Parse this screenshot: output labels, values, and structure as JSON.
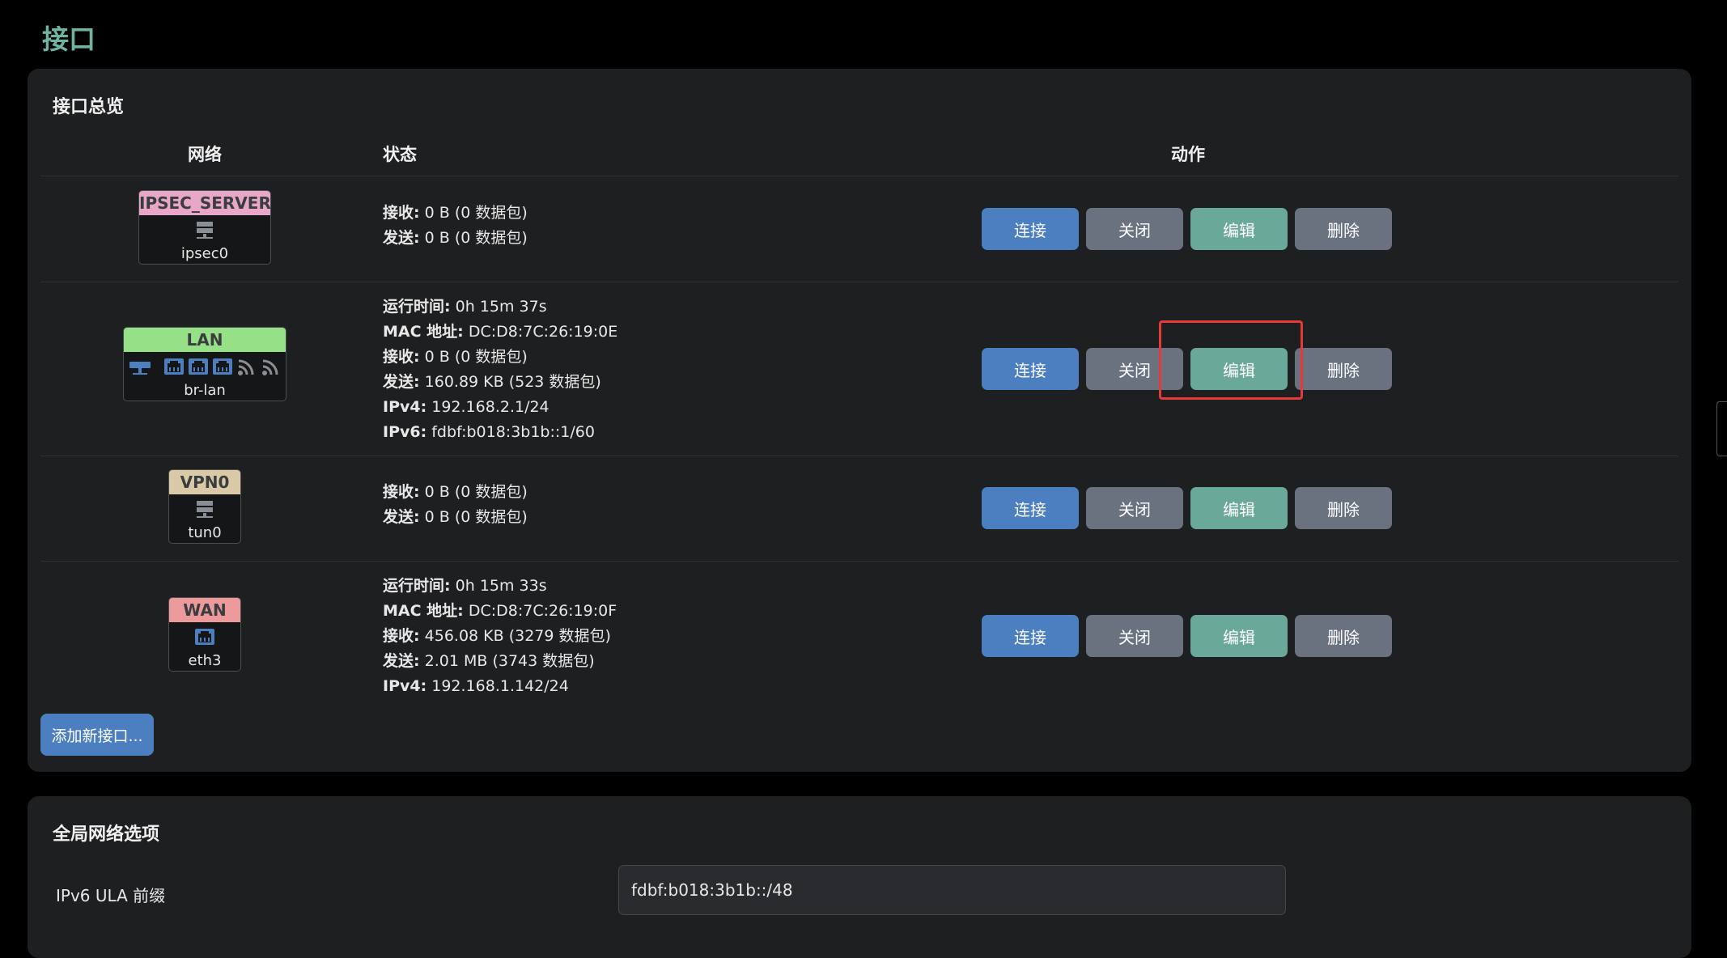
{
  "page": {
    "title": "接口"
  },
  "overview": {
    "title": "接口总览",
    "headers": {
      "network": "网络",
      "status": "状态",
      "actions": "动作"
    },
    "buttons": {
      "connect": "连接",
      "stop": "关闭",
      "edit": "编辑",
      "delete": "删除"
    },
    "add_button": "添加新接口...",
    "rows": [
      {
        "name": "IPSEC_SERVER",
        "device": "ipsec0",
        "color": "#e9a7c8",
        "icons": [
          "server-icon"
        ],
        "status": [
          {
            "k": "接收:",
            "v": " 0 B (0 数据包)"
          },
          {
            "k": "发送:",
            "v": " 0 B (0 数据包)"
          }
        ]
      },
      {
        "name": "LAN",
        "device": "br-lan",
        "color": "#96e187",
        "icons": [
          "bridge-icon",
          "ethernet-port-icon",
          "ethernet-port-icon",
          "ethernet-port-icon",
          "wifi-icon",
          "wifi-icon"
        ],
        "status": [
          {
            "k": "运行时间:",
            "v": " 0h 15m 37s"
          },
          {
            "k": "MAC 地址:",
            "v": " DC:D8:7C:26:19:0E"
          },
          {
            "k": "接收:",
            "v": " 0 B (0 数据包)"
          },
          {
            "k": "发送:",
            "v": " 160.89 KB (523 数据包)"
          },
          {
            "k": "IPv4:",
            "v": " 192.168.2.1/24"
          },
          {
            "k": "IPv6:",
            "v": " fdbf:b018:3b1b::1/60"
          }
        ]
      },
      {
        "name": "VPN0",
        "device": "tun0",
        "color": "#d9c9a6",
        "icons": [
          "server-icon"
        ],
        "status": [
          {
            "k": "接收:",
            "v": " 0 B (0 数据包)"
          },
          {
            "k": "发送:",
            "v": " 0 B (0 数据包)"
          }
        ]
      },
      {
        "name": "WAN",
        "device": "eth3",
        "color": "#ed9a9a",
        "icons": [
          "ethernet-port-icon"
        ],
        "status": [
          {
            "k": "运行时间:",
            "v": " 0h 15m 33s"
          },
          {
            "k": "MAC 地址:",
            "v": " DC:D8:7C:26:19:0F"
          },
          {
            "k": "接收:",
            "v": " 456.08 KB (3279 数据包)"
          },
          {
            "k": "发送:",
            "v": " 2.01 MB (3743 数据包)"
          },
          {
            "k": "IPv4:",
            "v": " 192.168.1.142/24"
          }
        ]
      }
    ]
  },
  "global": {
    "title": "全局网络选项",
    "ula_label": "IPv6 ULA 前缀",
    "ula_value": "fdbf:b018:3b1b::/48"
  },
  "colors": {
    "connect": "#4c7fc0",
    "stop": "#6a7280",
    "edit": "#6aa899",
    "delete": "#6a7280",
    "highlight": "#e43a3a",
    "title": "#6fb3a3"
  }
}
